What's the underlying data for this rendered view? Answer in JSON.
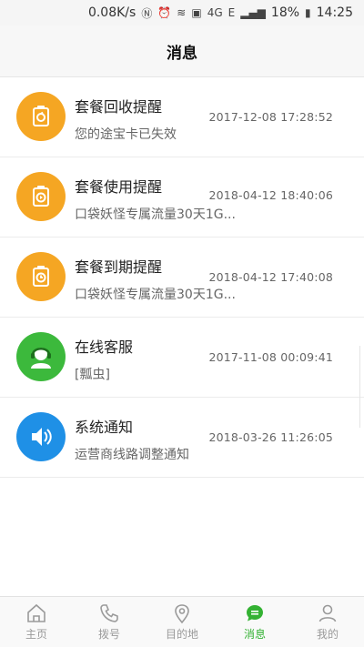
{
  "status": {
    "speed": "0.08K/s",
    "battery": "18%",
    "time": "14:25",
    "net1": "4G",
    "net2": "E"
  },
  "header": {
    "title": "消息"
  },
  "messages": [
    {
      "title": "套餐回收提醒",
      "subtitle": "您的途宝卡已失效",
      "time": "2017-12-08 17:28:52",
      "icon": "package-recycle-icon",
      "color": "#f5a623"
    },
    {
      "title": "套餐使用提醒",
      "subtitle": "口袋妖怪专属流量30天1G...",
      "time": "2018-04-12 18:40:06",
      "icon": "package-usage-icon",
      "color": "#f5a623"
    },
    {
      "title": "套餐到期提醒",
      "subtitle": "口袋妖怪专属流量30天1G...",
      "time": "2018-04-12 17:40:08",
      "icon": "package-expire-icon",
      "color": "#f5a623"
    },
    {
      "title": "在线客服",
      "subtitle": "[瓢虫]",
      "time": "2017-11-08 00:09:41",
      "icon": "customer-service-icon",
      "color": "#3cb93c"
    },
    {
      "title": "系统通知",
      "subtitle": "运营商线路调整通知",
      "time": "2018-03-26 11:26:05",
      "icon": "speaker-icon",
      "color": "#1f90e6"
    }
  ],
  "tabs": [
    {
      "label": "主页",
      "icon": "home-icon"
    },
    {
      "label": "拨号",
      "icon": "phone-icon"
    },
    {
      "label": "目的地",
      "icon": "location-pin-icon"
    },
    {
      "label": "消息",
      "icon": "message-icon",
      "active": true
    },
    {
      "label": "我的",
      "icon": "profile-icon"
    }
  ],
  "colors": {
    "accent": "#34b233",
    "orange": "#f5a623",
    "blue": "#1f90e6"
  }
}
